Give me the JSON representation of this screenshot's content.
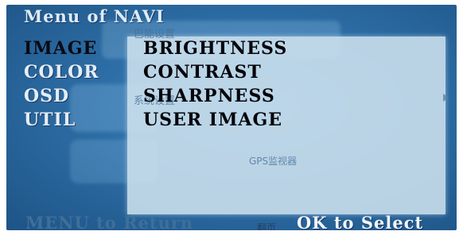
{
  "title": "Menu of  NAVI",
  "main_menu": [
    {
      "label": "IMAGE",
      "active": true
    },
    {
      "label": "COLOR",
      "active": false
    },
    {
      "label": "OSD",
      "active": false
    },
    {
      "label": "UTIL",
      "active": false
    }
  ],
  "sub_menu": [
    {
      "label": "BRIGHTNESS"
    },
    {
      "label": "CONTRAST"
    },
    {
      "label": "SHARPNESS"
    },
    {
      "label": "USER IMAGE"
    }
  ],
  "background_text": {
    "top": "巴能设置",
    "middle": "系统设置",
    "lower": "GPS监视器",
    "bottom": "翻页"
  },
  "footer": {
    "back_hint": "MENU to Return",
    "select_hint": "OK to Select"
  },
  "colors": {
    "screen_blue": "#2d6ea6",
    "panel": "#cde1ee",
    "active_text": "#0a0a14",
    "menu_text": "#e4edf4"
  }
}
